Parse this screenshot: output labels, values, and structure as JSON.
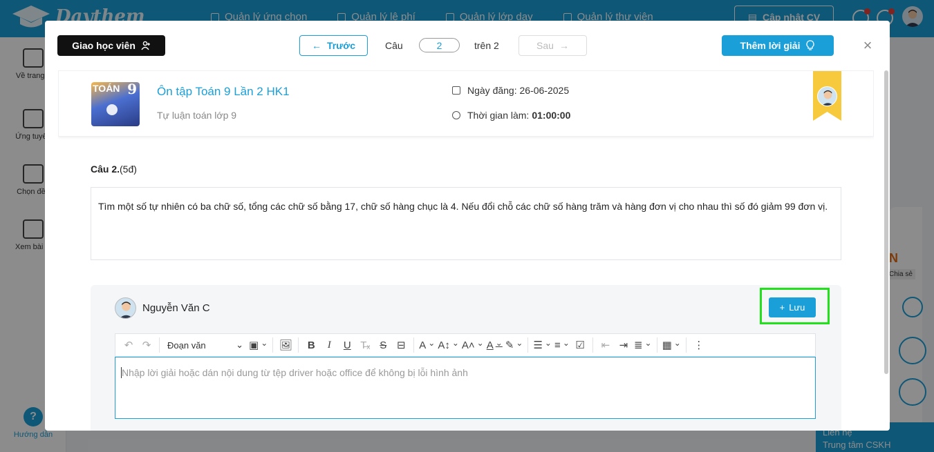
{
  "app": {
    "brand": "Daythem",
    "nav": [
      "Quản lý ứng chọn",
      "Quản lý lệ phí",
      "Quản lý lớp dạy",
      "Quản lý thư viện"
    ],
    "update_cv": "Cập nhật CV",
    "sidebar": [
      "Về trang c",
      "Ứng tuyển",
      "Chọn đề t",
      "Xem bài gi"
    ],
    "help": "Hướng dẫn",
    "contact_title": "Liên hệ",
    "contact_sub": "Trung tâm CSKH",
    "right_letter": "N",
    "right_share": "Chia sẻ"
  },
  "modal": {
    "assign_button": "Giao học viên",
    "prev_button": "Trước",
    "question_label": "Câu",
    "question_number": "2",
    "of_total": "trên 2",
    "next_button": "Sau",
    "add_solution_button": "Thêm lời giải",
    "close": "×",
    "exam": {
      "thumb_text": "TOÁN",
      "thumb_number": "9",
      "title": "Ôn tập Toán 9 Lần 2 HK1",
      "subtitle": "Tự luận toán lớp 9",
      "post_date": "Ngày đăng: 26-06-2025",
      "duration_label": "Thời gian làm:",
      "duration_value": "01:00:00"
    },
    "question": {
      "label": "Câu 2.",
      "points": "(5đ)",
      "text": "Tìm một số tự nhiên có ba chữ số, tổng các chữ số bằng 17, chữ số hàng chục là 4. Nếu đổi chỗ các chữ số hàng trăm và hàng đơn vị cho nhau thì số đó giảm 99 đơn vị."
    },
    "answer": {
      "author": "Nguyễn Văn C",
      "save_button": "Lưu",
      "paragraph_style": "Đoạn văn",
      "placeholder": "Nhập lời giải hoặc dán nội dung từ tệp driver hoặc office để không bị lỗi hình ảnh"
    }
  },
  "colors": {
    "accent": "#1a9fd8",
    "highlight_box": "#22e01c",
    "ribbon": "#f7c93c"
  }
}
